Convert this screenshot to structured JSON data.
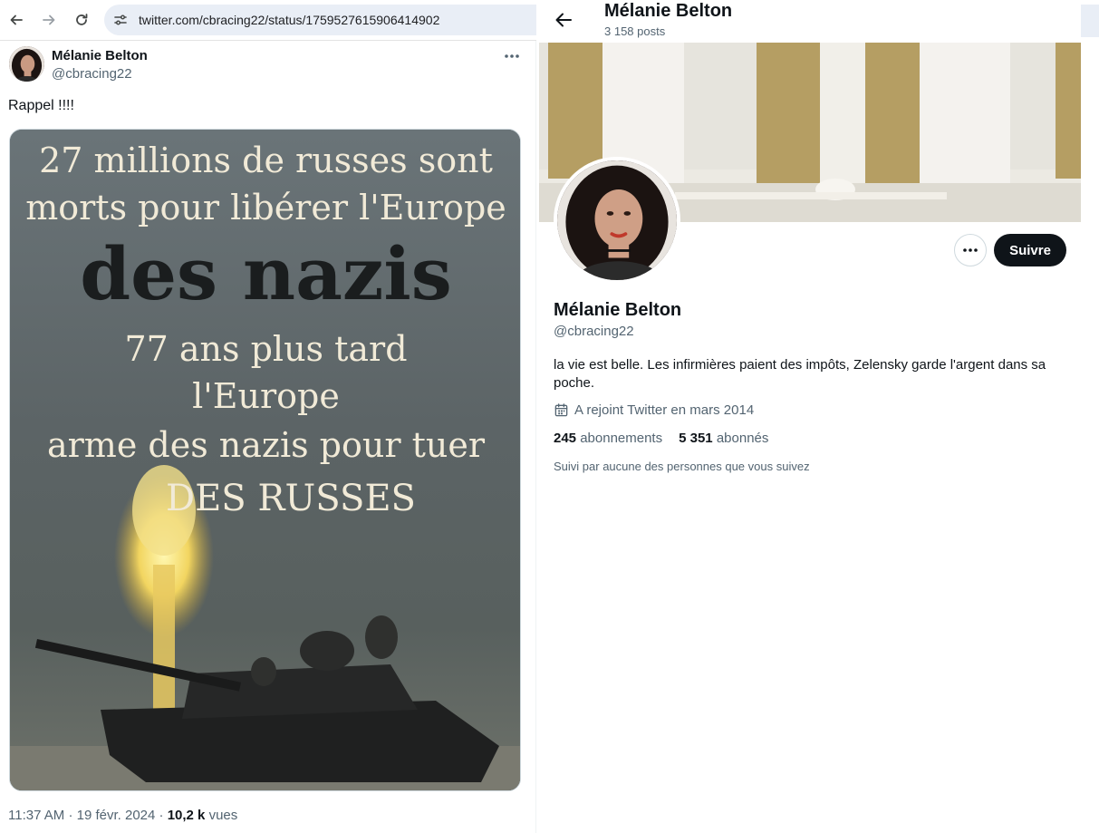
{
  "browser": {
    "url": "twitter.com/cbracing22/status/1759527615906414902"
  },
  "tweet": {
    "author_name": "Mélanie Belton",
    "author_handle": "@cbracing22",
    "text": "Rappel !!!!",
    "image_text": {
      "line1": "27 millions de russes sont",
      "line2": "morts pour libérer l'Europe",
      "line3": "des nazis",
      "line4": "77 ans plus tard",
      "line5": "l'Europe",
      "line6": "arme des nazis pour tuer",
      "line7": "DES RUSSES"
    },
    "time": "11:37 AM",
    "date": "19 févr. 2024",
    "views_count": "10,2 k",
    "views_label": "vues"
  },
  "profile": {
    "header_name": "Mélanie Belton",
    "posts_count": "3 158 posts",
    "follow_label": "Suivre",
    "name": "Mélanie Belton",
    "handle": "@cbracing22",
    "bio": "la vie est belle. Les infirmières paient des impôts, Zelensky garde l'argent dans sa poche.",
    "joined": "A rejoint Twitter en mars 2014",
    "following_count": "245",
    "following_label": "abonnements",
    "followers_count": "5 351",
    "followers_label": "abonnés",
    "followed_by": "Suivi par aucune des personnes que vous suivez"
  },
  "icons": {
    "back": "arrow-left-icon",
    "forward": "arrow-right-icon",
    "reload": "reload-icon",
    "site_settings": "tune-icon",
    "more": "more-horizontal-icon",
    "calendar": "calendar-icon"
  },
  "colors": {
    "follow_button": "#0f1419",
    "secondary_text": "#536471",
    "url_bar": "#e9eef6"
  }
}
